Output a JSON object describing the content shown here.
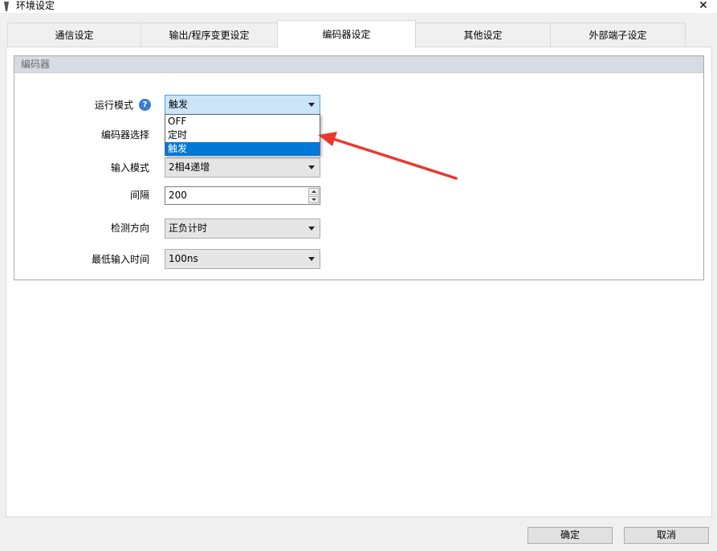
{
  "window": {
    "title": "环境设定",
    "close_glyph": "✕"
  },
  "tabs": [
    {
      "label": "通信设定"
    },
    {
      "label": "输出/程序变更设定"
    },
    {
      "label": "编码器设定"
    },
    {
      "label": "其他设定"
    },
    {
      "label": "外部端子设定"
    }
  ],
  "group": {
    "title": "编码器"
  },
  "form": {
    "run_mode": {
      "label": "运行模式",
      "value": "触发",
      "help_icon": "question-circle-icon"
    },
    "run_mode_options": [
      "OFF",
      "定时",
      "触发"
    ],
    "encoder_select": {
      "label": "编码器选择"
    },
    "input_mode": {
      "label": "输入模式",
      "value": "2相4递增"
    },
    "interval": {
      "label": "间隔",
      "value": "200"
    },
    "direction": {
      "label": "检测方向",
      "value": "正负计时"
    },
    "min_input_time": {
      "label": "最低输入时间",
      "value": "100ns"
    }
  },
  "footer": {
    "ok_label": "确定",
    "cancel_label": "取消"
  },
  "colors": {
    "selection": "#0078d7",
    "annotation_arrow": "#e8392f",
    "group_header": "#d7dbe3"
  }
}
